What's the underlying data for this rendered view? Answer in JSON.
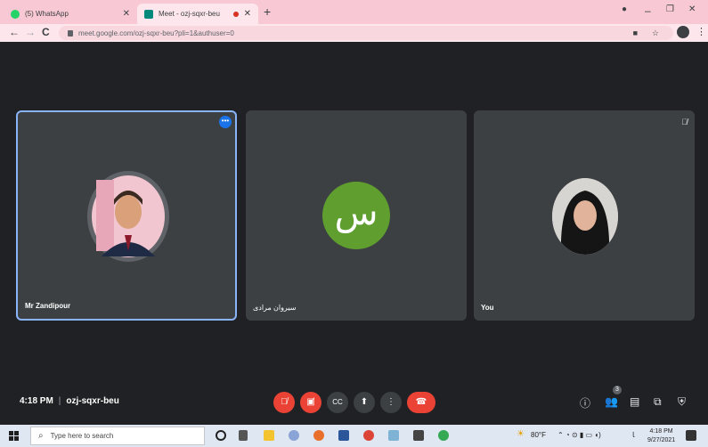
{
  "browser": {
    "tabs": [
      {
        "title": "(5) WhatsApp",
        "favicon_color": "#25d366"
      },
      {
        "title": "Meet - ozj-sqxr-beu",
        "favicon_color": "#00897b",
        "recording": true
      }
    ],
    "new_tab": "+",
    "window_controls": {
      "minimize": "–",
      "restore": "❐",
      "close": "✕"
    },
    "url": "meet.google.com/ozj-sqxr-beu?pli=1&authuser=0"
  },
  "meeting": {
    "participants": [
      {
        "name": "Mr Zandipour",
        "active_speaker": true,
        "avatar": "photo-man"
      },
      {
        "name": "سیروان مرادی",
        "avatar_letter": "س",
        "avatar_color": "#5f9e2f"
      },
      {
        "name": "You",
        "avatar": "photo-woman",
        "muted": true
      }
    ],
    "time": "4:18 PM",
    "separator": "|",
    "code": "ozj-sqxr-beu",
    "people_count": "3"
  },
  "taskbar": {
    "search_placeholder": "Type here to search",
    "weather": "80°F",
    "clock_time": "4:18 PM",
    "clock_date": "9/27/2021"
  },
  "colors": {
    "accent_blue": "#8ab4f8",
    "end_call_red": "#ea4335",
    "stage_bg": "#202124",
    "tile_bg": "#3c4043"
  }
}
